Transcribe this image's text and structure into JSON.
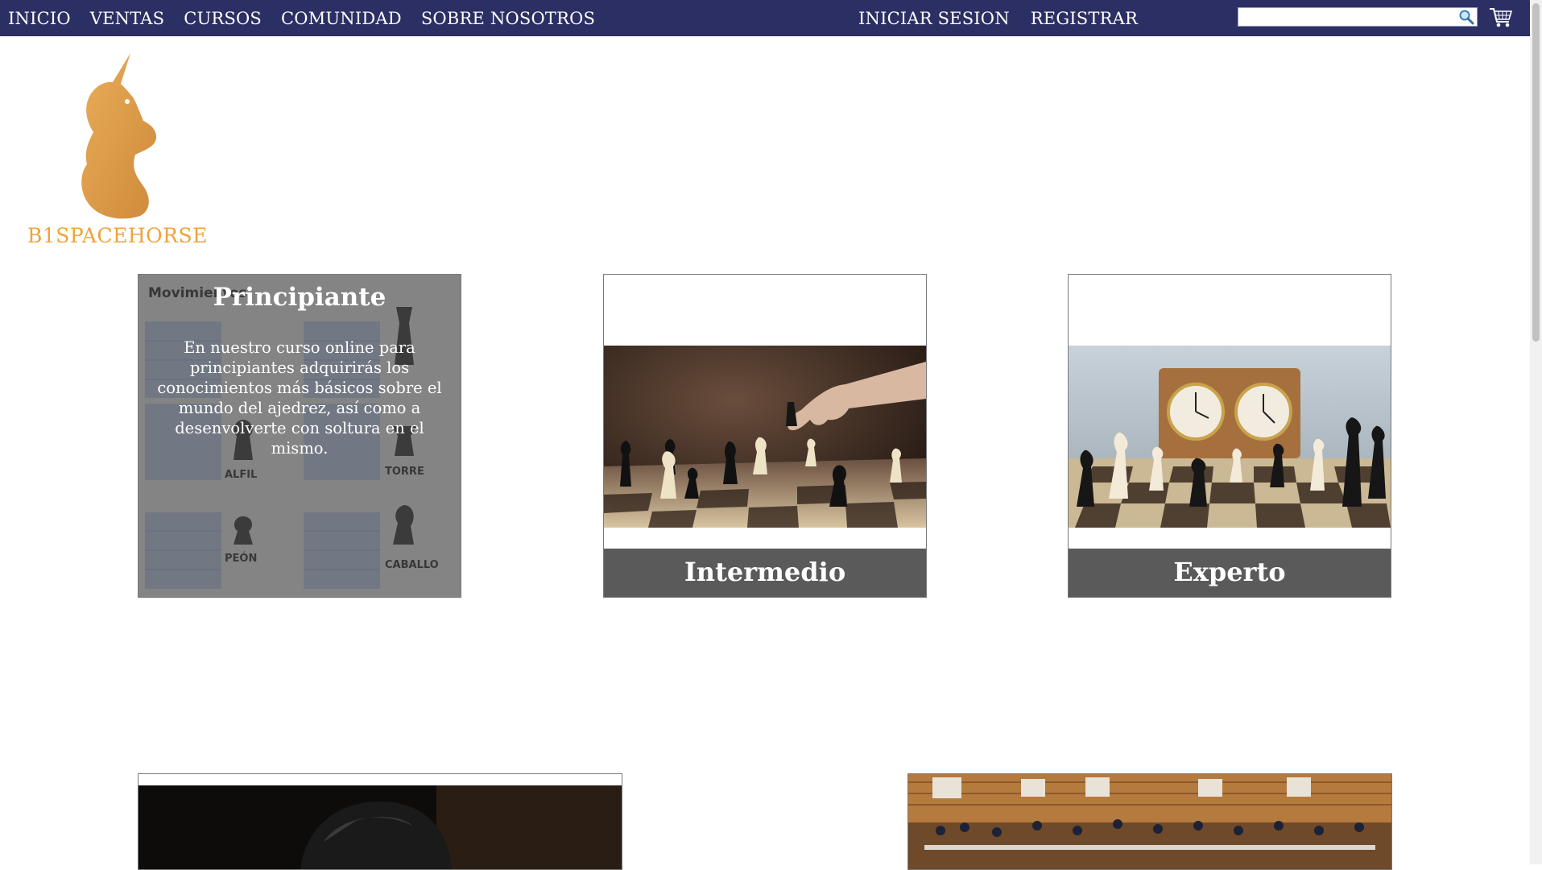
{
  "nav": {
    "links": [
      "INICIO",
      "VENTAS",
      "CURSOS",
      "COMUNIDAD",
      "SOBRE NOSOTROS"
    ],
    "account": [
      "INICIAR SESION",
      "REGISTRAR"
    ],
    "search_value": ""
  },
  "brand": {
    "name": "B1SPACEHORSE",
    "color": "#f0a23a"
  },
  "colors": {
    "nav_bg": "#2b2f63",
    "card_footer": "#5a5a5a"
  },
  "courses": {
    "beginner": {
      "title": "Principiante",
      "description": "En nuestro curso online para principiantes adquirirás los conocimientos más básicos sobre el mundo del ajedrez, así como a desenvolverte con soltura en el mismo.",
      "bg_heading": "Movimiento",
      "pieces": [
        "ALFIL",
        "TORRE",
        "PEÓN",
        "CABALLO"
      ]
    },
    "intermediate": {
      "title": "Intermedio"
    },
    "expert": {
      "title": "Experto"
    }
  },
  "icons": {
    "search": "magnifier-icon",
    "cart": "shopping-cart-icon",
    "logo": "unicorn-knight-icon"
  }
}
